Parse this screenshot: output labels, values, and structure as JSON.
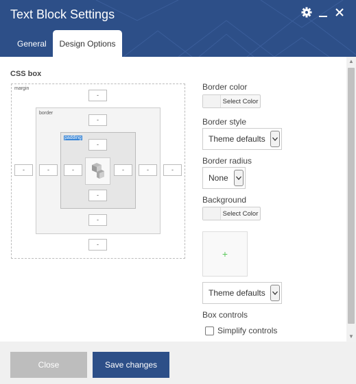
{
  "window": {
    "title": "Text Block Settings",
    "header_color": "#2d4f88",
    "icons": [
      "gear-icon",
      "minimize-icon",
      "close-icon"
    ]
  },
  "tabs": [
    {
      "label": "General",
      "active": false
    },
    {
      "label": "Design Options",
      "active": true
    }
  ],
  "css_box": {
    "heading": "CSS box",
    "margin_label": "margin",
    "border_label": "border",
    "padding_label": "padding",
    "values": {
      "margin_top": "-",
      "margin_bottom": "-",
      "margin_left": "-",
      "margin_right": "-",
      "border_top": "-",
      "border_bottom": "-",
      "border_left": "-",
      "border_right": "-",
      "padding_top": "-",
      "padding_bottom": "-",
      "padding_left": "-",
      "padding_right": "-"
    }
  },
  "options": {
    "border_color_label": "Border color",
    "border_color_button": "Select Color",
    "border_style_label": "Border style",
    "border_style_value": "Theme defaults",
    "border_radius_label": "Border radius",
    "border_radius_value": "None",
    "background_label": "Background",
    "background_color_button": "Select Color",
    "background_image_icon": "plus-icon",
    "background_style_value": "Theme defaults",
    "box_controls_label": "Box controls",
    "simplify_label": "Simplify controls",
    "simplify_checked": false
  },
  "footer": {
    "close_label": "Close",
    "save_label": "Save changes",
    "save_color": "#2d4f88"
  }
}
